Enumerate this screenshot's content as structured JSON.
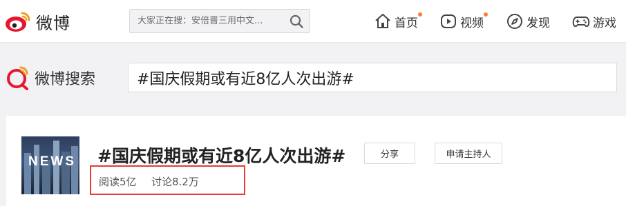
{
  "brand": {
    "name": "微博"
  },
  "topbar": {
    "search_placeholder": "大家正在搜：安倍晋三用中文...",
    "nav": [
      {
        "label": "首页",
        "icon": "home-icon",
        "badge": true
      },
      {
        "label": "视频",
        "icon": "video-icon",
        "badge": true
      },
      {
        "label": "发现",
        "icon": "compass-icon",
        "badge": false
      },
      {
        "label": "游戏",
        "icon": "gamepad-icon",
        "badge": false
      }
    ]
  },
  "search_header": {
    "label": "微博搜索",
    "query": "#国庆假期或有近8亿人次出游#"
  },
  "topic": {
    "thumbnail_text": "NEWS",
    "title": "#国庆假期或有近8亿人次出游#",
    "share_label": "分享",
    "host_label": "申请主持人",
    "reads": "阅读5亿",
    "discussions": "讨论8.2万"
  },
  "colors": {
    "accent": "#fa7d3c",
    "highlight_box": "#e53a3a",
    "weibo_red": "#e6162d"
  }
}
